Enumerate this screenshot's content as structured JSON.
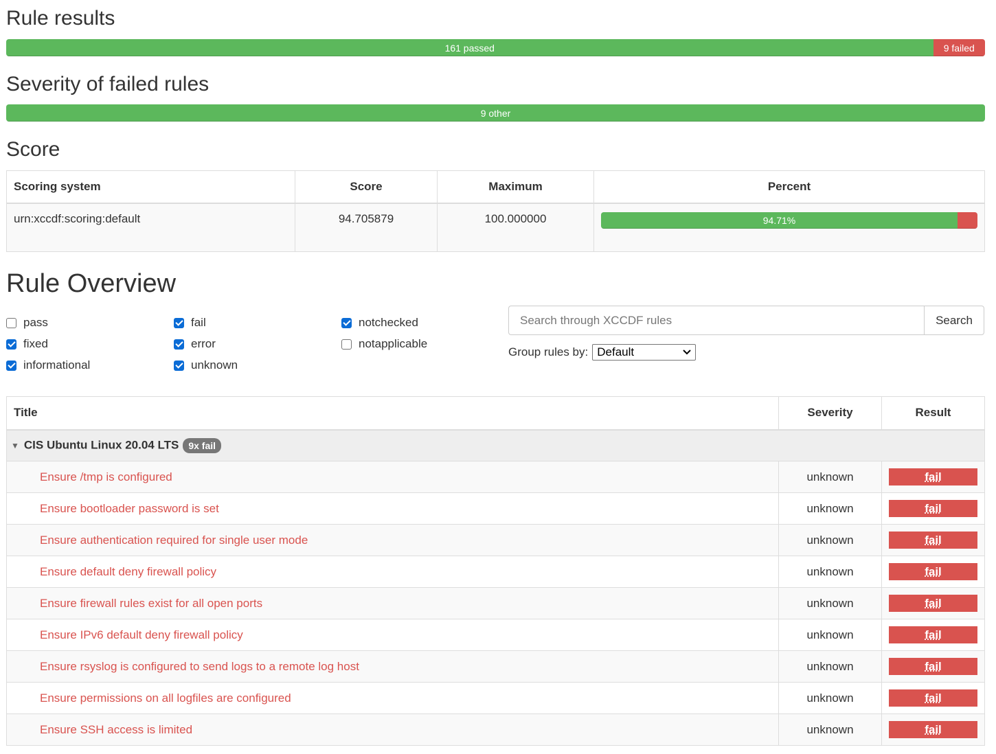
{
  "rule_results": {
    "heading": "Rule results",
    "passed_label": "161 passed",
    "failed_label": "9 failed",
    "passed_count": 161,
    "failed_count": 9
  },
  "severity": {
    "heading": "Severity of failed rules",
    "other_label": "9 other"
  },
  "score": {
    "heading": "Score",
    "columns": [
      "Scoring system",
      "Score",
      "Maximum",
      "Percent"
    ],
    "row": {
      "system": "urn:xccdf:scoring:default",
      "score": "94.705879",
      "maximum": "100.000000",
      "percent_label": "94.71%",
      "percent_value": 94.71
    }
  },
  "overview": {
    "heading": "Rule Overview",
    "filters": [
      {
        "label": "pass",
        "checked": false
      },
      {
        "label": "fixed",
        "checked": true
      },
      {
        "label": "informational",
        "checked": true
      },
      {
        "label": "fail",
        "checked": true
      },
      {
        "label": "error",
        "checked": true
      },
      {
        "label": "unknown",
        "checked": true
      },
      {
        "label": "notchecked",
        "checked": true
      },
      {
        "label": "notapplicable",
        "checked": false
      }
    ],
    "search_placeholder": "Search through XCCDF rules",
    "search_button": "Search",
    "group_by_label": "Group rules by:",
    "group_by_value": "Default"
  },
  "rules_table": {
    "columns": [
      "Title",
      "Severity",
      "Result"
    ],
    "group": {
      "title": "CIS Ubuntu Linux 20.04 LTS",
      "badge": "9x fail"
    },
    "rows": [
      {
        "title": "Ensure /tmp is configured",
        "severity": "unknown",
        "result": "fail"
      },
      {
        "title": "Ensure bootloader password is set",
        "severity": "unknown",
        "result": "fail"
      },
      {
        "title": "Ensure authentication required for single user mode",
        "severity": "unknown",
        "result": "fail"
      },
      {
        "title": "Ensure default deny firewall policy",
        "severity": "unknown",
        "result": "fail"
      },
      {
        "title": "Ensure firewall rules exist for all open ports",
        "severity": "unknown",
        "result": "fail"
      },
      {
        "title": "Ensure IPv6 default deny firewall policy",
        "severity": "unknown",
        "result": "fail"
      },
      {
        "title": "Ensure rsyslog is configured to send logs to a remote log host",
        "severity": "unknown",
        "result": "fail"
      },
      {
        "title": "Ensure permissions on all logfiles are configured",
        "severity": "unknown",
        "result": "fail"
      },
      {
        "title": "Ensure SSH access is limited",
        "severity": "unknown",
        "result": "fail"
      }
    ]
  },
  "colors": {
    "success": "#5cb85c",
    "danger": "#d9534f"
  }
}
